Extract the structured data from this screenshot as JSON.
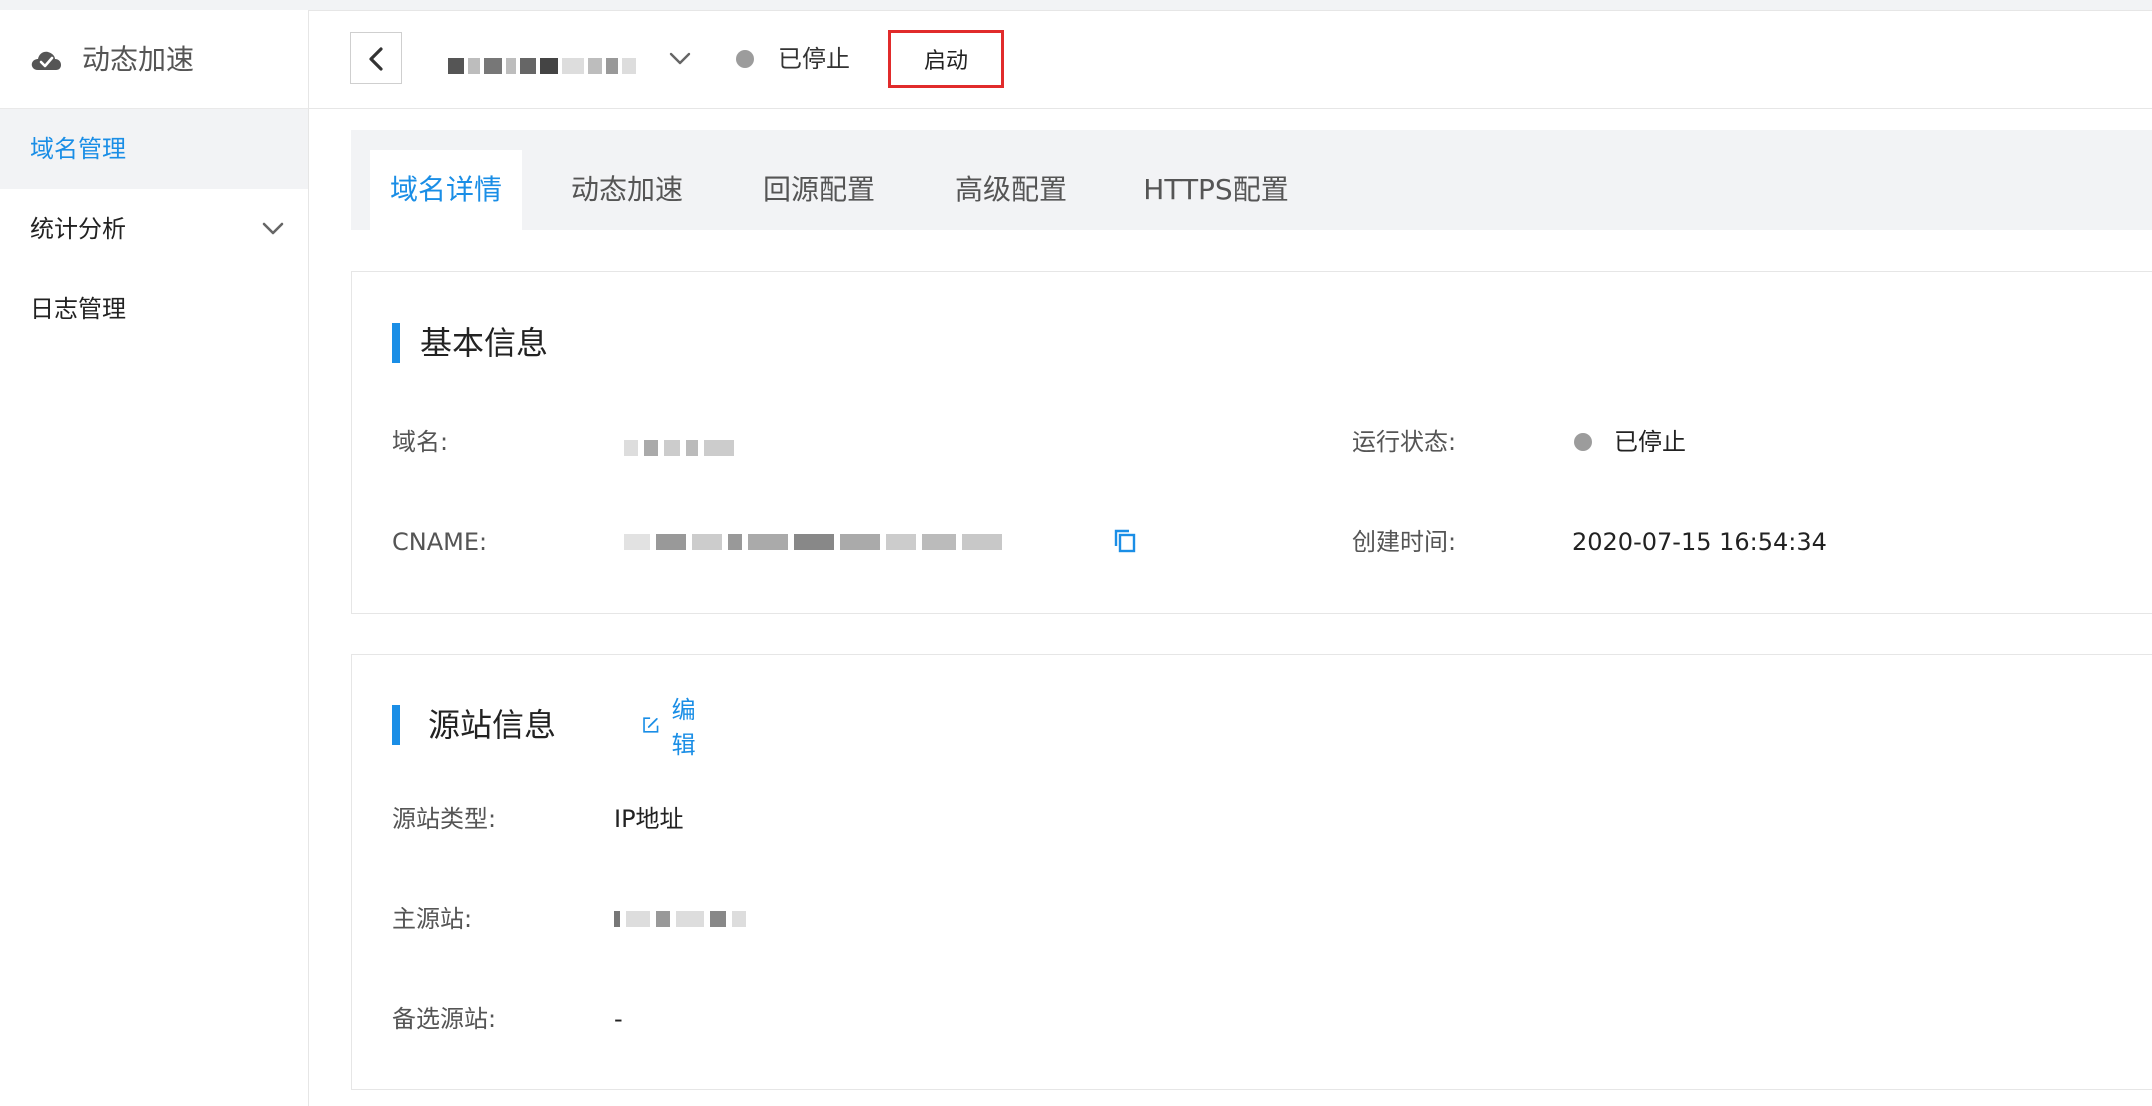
{
  "sidebar": {
    "title": "动态加速",
    "items": [
      {
        "label": "域名管理",
        "active": true
      },
      {
        "label": "统计分析",
        "active": false,
        "expandable": true
      },
      {
        "label": "日志管理",
        "active": false
      }
    ]
  },
  "header": {
    "status": "已停止",
    "start_button": "启动"
  },
  "tabs": [
    {
      "label": "域名详情",
      "active": true
    },
    {
      "label": "动态加速",
      "active": false
    },
    {
      "label": "回源配置",
      "active": false
    },
    {
      "label": "高级配置",
      "active": false
    },
    {
      "label": "HTTPS配置",
      "active": false
    }
  ],
  "basic_info": {
    "title": "基本信息",
    "domain_label": "域名:",
    "cname_label": "CNAME:",
    "status_label": "运行状态:",
    "status_value": "已停止",
    "created_label": "创建时间:",
    "created_value": "2020-07-15 16:54:34"
  },
  "origin_info": {
    "title": "源站信息",
    "edit_label": "编辑",
    "type_label": "源站类型:",
    "type_value": "IP地址",
    "primary_label": "主源站:",
    "backup_label": "备选源站:",
    "backup_value": "-"
  },
  "colors": {
    "accent": "#1a8ee6",
    "highlight_border": "#e12b2b",
    "status_stopped": "#9c9c9c"
  },
  "icons": {
    "sidebar_logo": "cloud-check-icon",
    "back": "chevron-left-icon",
    "dropdown": "chevron-down-icon",
    "copy": "copy-icon",
    "edit": "edit-icon"
  }
}
